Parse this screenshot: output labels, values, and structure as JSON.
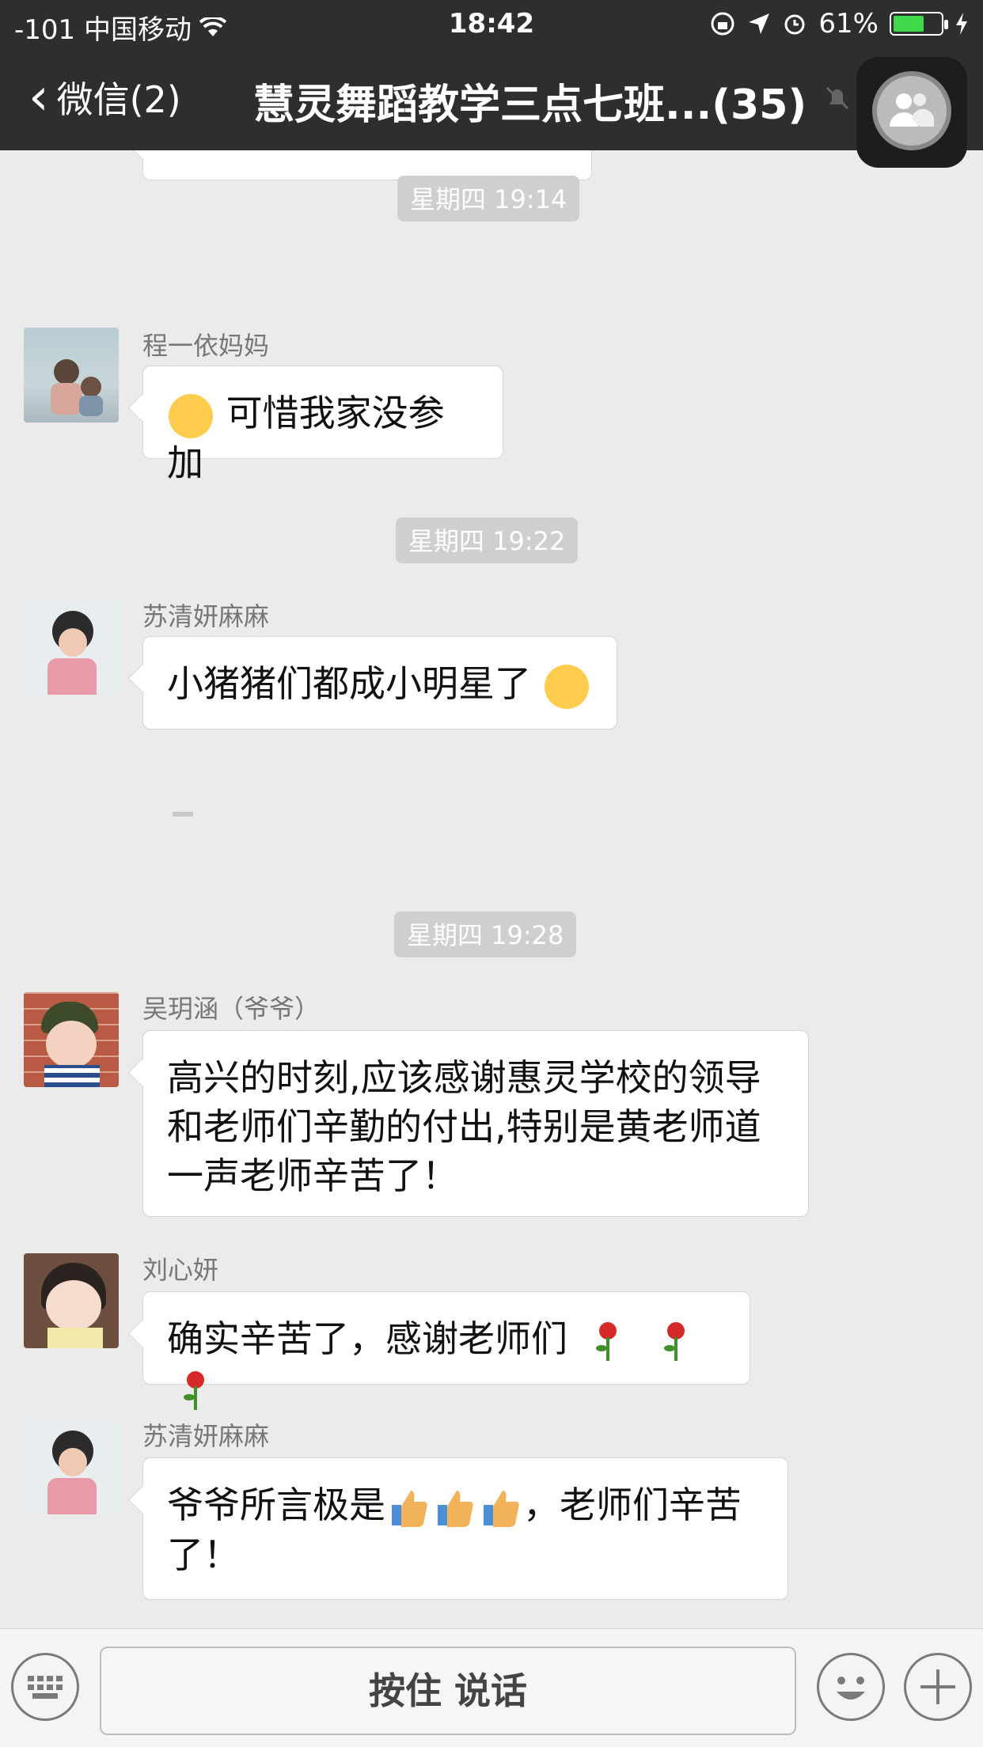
{
  "status_bar": {
    "carrier": "-101 中国移动",
    "time": "18:42",
    "battery": "61%"
  },
  "nav": {
    "back_label": "微信(2)",
    "title": "慧灵舞蹈教学三点七班...(35)"
  },
  "messages": [
    {
      "type": "time",
      "text": "星期四 19:14"
    },
    {
      "type": "msg",
      "sender": "程一依妈妈",
      "text": "可惜我家没参加"
    },
    {
      "type": "time",
      "text": "星期四 19:22"
    },
    {
      "type": "msg",
      "sender": "苏清妍麻麻",
      "text": "小猪猪们都成小明星了"
    },
    {
      "type": "time",
      "text": "星期四 19:28"
    },
    {
      "type": "msg",
      "sender": "吴玥涵（爷爷）",
      "lines": [
        "高兴的时刻,应该感谢惠灵学校的领导",
        "和老师们辛勤的付出,特别是黄老师道",
        "一声老师辛苦了！"
      ]
    },
    {
      "type": "msg",
      "sender": "刘心妍",
      "text": "确实辛苦了，感谢老师们"
    },
    {
      "type": "msg",
      "sender": "苏清妍麻麻",
      "text_a": "爷爷所言极是",
      "text_b": "，老师们辛苦",
      "text_c": "了！"
    }
  ],
  "input_bar": {
    "hold_to_talk": "按住 说话"
  }
}
